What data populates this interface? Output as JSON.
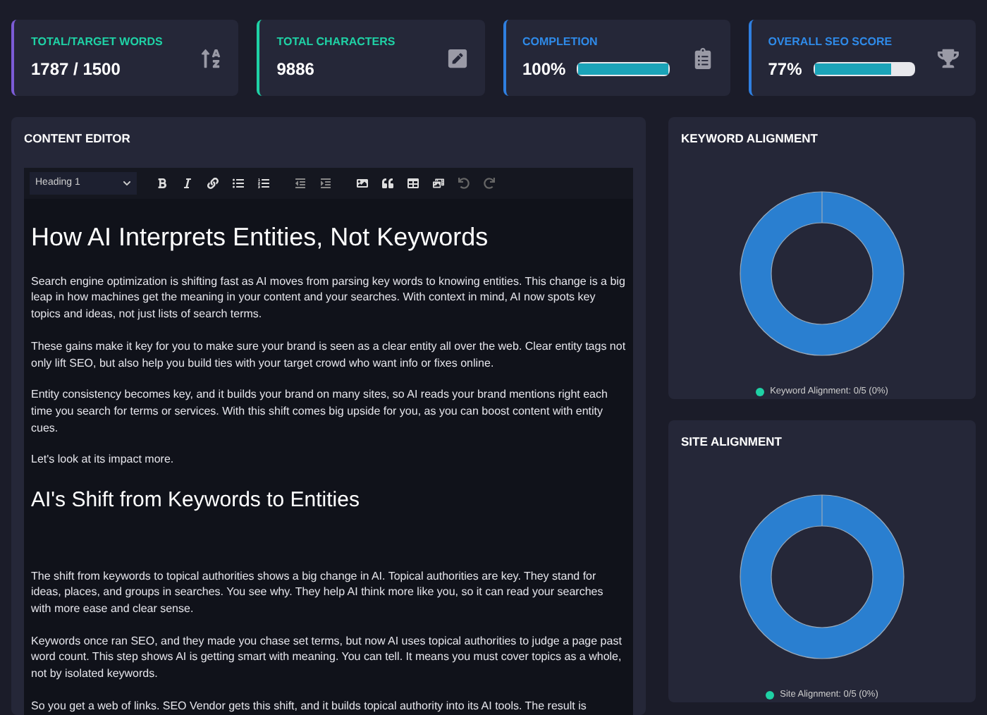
{
  "stats": [
    {
      "kind": "value",
      "label": "TOTAL/TARGET WORDS",
      "value": "1787 / 1500",
      "color": "#7c5cd6"
    },
    {
      "kind": "value",
      "label": "TOTAL CHARACTERS",
      "value": "9886",
      "color": "#1fd1a5"
    },
    {
      "kind": "progress",
      "label": "COMPLETION",
      "value": "100%",
      "level": 1,
      "color": "#2f7fe0"
    },
    {
      "kind": "progress",
      "label": "OVERALL SEO SCORE",
      "value": "77%",
      "level": 0.77,
      "color": "#2f7fe0"
    }
  ],
  "editor": {
    "title": "CONTENT EDITOR",
    "block_format": "Heading 1",
    "content": [
      {
        "kind": "h1",
        "text": "How AI Interprets Entities, Not Keywords"
      },
      {
        "kind": "p",
        "text": "Search engine optimization is shifting fast as AI moves from parsing key words to knowing entities. This change is a big leap in how machines get the meaning in your content and your searches. With context in mind, AI now spots key topics and ideas, not just lists of search terms."
      },
      {
        "kind": "p",
        "text": "These gains make it key for you to make sure your brand is seen as a clear entity all over the web. Clear entity tags not only lift SEO, but also help you build ties with your target crowd who want info or fixes online."
      },
      {
        "kind": "p",
        "text": "Entity consistency becomes key, and it builds your brand on many sites, so AI reads your brand mentions right each time you search for terms or services. With this shift comes big upside for you, as you can boost content with entity cues."
      },
      {
        "kind": "p",
        "text": "Let's look at its impact more."
      },
      {
        "kind": "h2",
        "text": "AI's Shift from Keywords to Entities"
      },
      {
        "kind": "p",
        "text": "The shift from keywords to topical authorities shows a big change in AI. Topical authorities are key. They stand for ideas, places, and groups in searches. You see why. They help AI think more like you, so it can read your searches with more ease and clear sense."
      },
      {
        "kind": "p",
        "text": "Keywords once ran SEO, and they made you chase set terms, but now AI uses topical authorities to judge a page past word count. This step shows AI is getting smart with meaning. You can tell. It means you must cover topics as a whole, not by isolated keywords."
      },
      {
        "kind": "p",
        "text": "So you get a web of links. SEO Vendor gets this shift, and it builds topical authority into its AI tools. The result is"
      }
    ]
  },
  "panels": [
    {
      "title": "KEYWORD ALIGNMENT",
      "legend": "Keyword Alignment: 0/5 (0%)"
    },
    {
      "title": "SITE ALIGNMENT",
      "legend": "Site Alignment: 0/5 (0%)"
    }
  ]
}
